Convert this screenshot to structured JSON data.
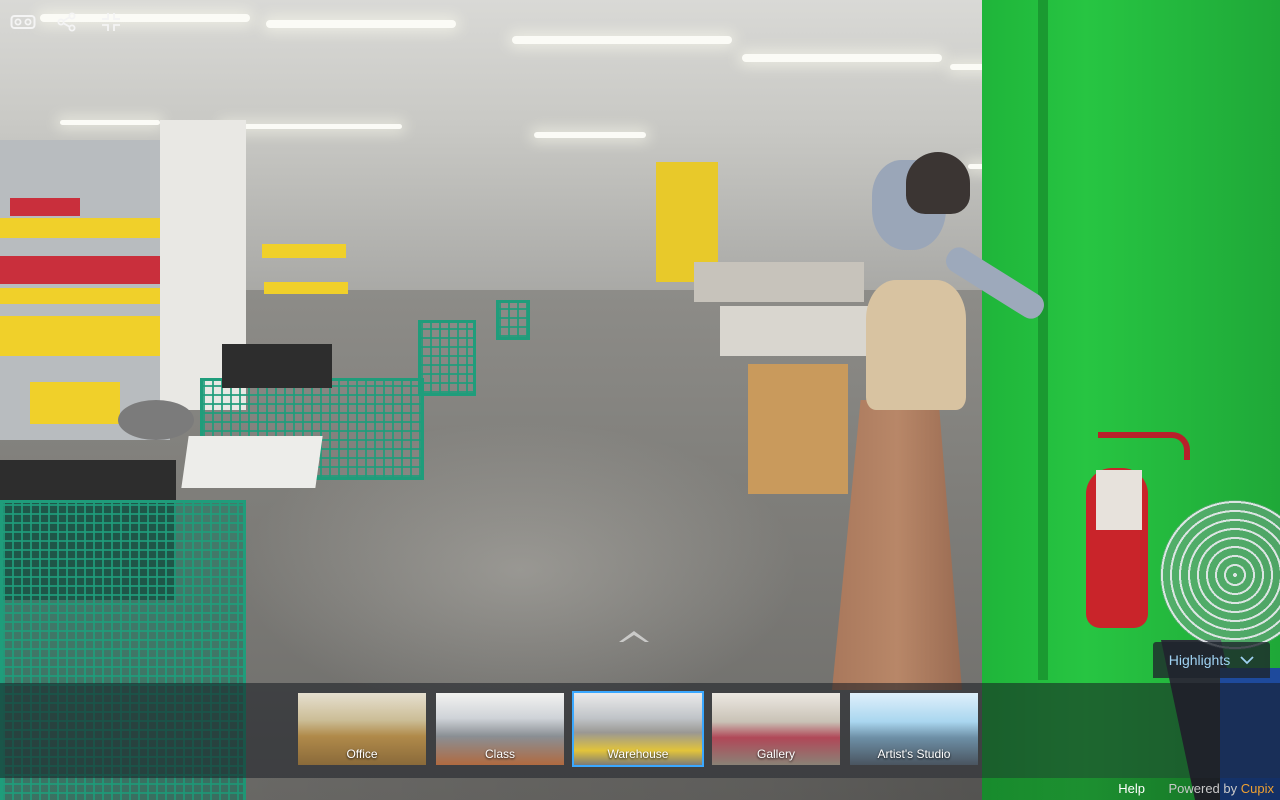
{
  "toolbar": {
    "vr_icon": "vr-headset-icon",
    "share_icon": "share-icon",
    "fullscreen_icon": "fullscreen-icon"
  },
  "navigation": {
    "forward_icon": "chevron-up-icon"
  },
  "highlights": {
    "label": "Highlights",
    "icon": "chevron-down-icon"
  },
  "scenes": [
    {
      "label": "Office",
      "active": false
    },
    {
      "label": "Class",
      "active": false
    },
    {
      "label": "Warehouse",
      "active": true
    },
    {
      "label": "Gallery",
      "active": false
    },
    {
      "label": "Artist's Studio",
      "active": false
    }
  ],
  "footer": {
    "help_label": "Help",
    "powered_prefix": "Powered by",
    "brand": "Cupix"
  },
  "colors": {
    "active_thumb_border": "#3aa8ff",
    "highlights_text": "#9fd2f2",
    "brand": "#f0a030"
  }
}
